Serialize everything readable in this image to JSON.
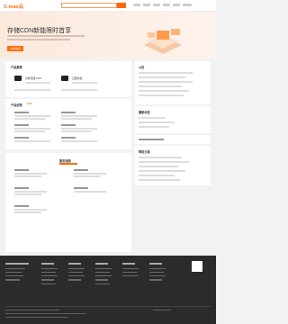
{
  "header": {
    "logo_text": "C-mas云",
    "search_placeholder": "",
    "brand_color": "#ff6a00"
  },
  "hero": {
    "title": "存储CDN新能限时首享",
    "button_label": "立即购买"
  },
  "main": {
    "section_products": "产品推荐",
    "product1_label": "对象存储 OSS",
    "product2_label": "云服务器",
    "section_features": "产品优势",
    "section_services": "服务指南"
  },
  "side": {
    "notice_title": "公告",
    "news_title": "最新动态",
    "help_title": "帮助文档"
  },
  "tags": {
    "new_label": "NEW"
  }
}
